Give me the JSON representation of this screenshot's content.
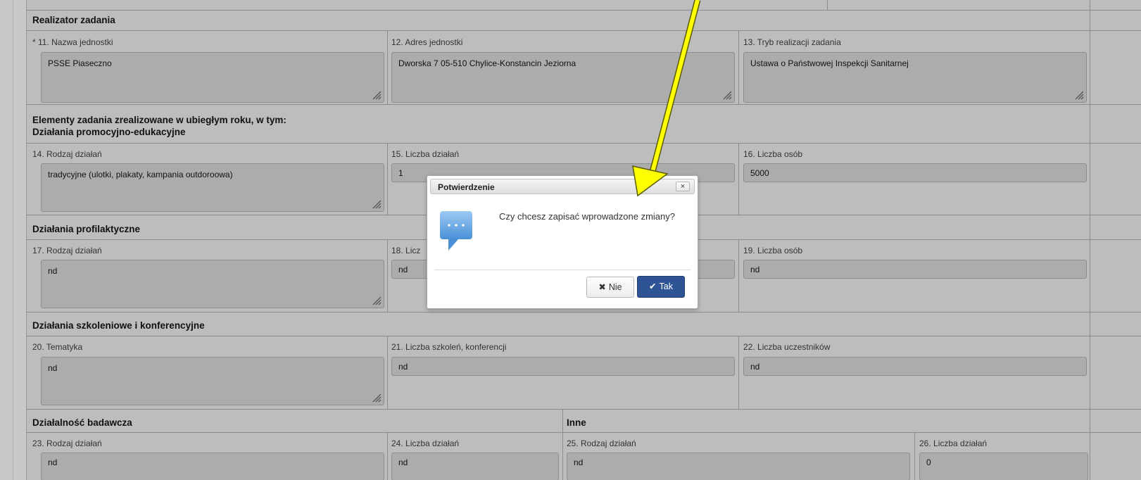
{
  "sections": {
    "realizator": "Realizator zadania",
    "elementy_line1": "Elementy zadania zrealizowane w ubiegłym roku, w tym:",
    "elementy_line2": "Działania promocyjno-edukacyjne",
    "profilaktyczne": "Działania profilaktyczne",
    "szkoleniowe": "Działania szkoleniowe i konferencyjne",
    "badawcza": "Działalność badawcza",
    "inne": "Inne"
  },
  "fields": {
    "f11": {
      "required_mark": "*",
      "label": "11. Nazwa jednostki",
      "value": "PSSE Piaseczno"
    },
    "f12": {
      "label": "12. Adres jednostki",
      "value": "Dworska 7 05-510 Chylice-Konstancin Jeziorna"
    },
    "f13": {
      "label": "13. Tryb realizacji zadania",
      "value": "Ustawa o Państwowej Inspekcji Sanitarnej"
    },
    "f14": {
      "label": "14. Rodzaj działań",
      "value": "tradycyjne (ulotki, plakaty, kampania outdoroowa)"
    },
    "f15": {
      "label": "15. Liczba działań",
      "value": "1"
    },
    "f16": {
      "label": "16. Liczba osób",
      "value": "5000"
    },
    "f17": {
      "label": "17. Rodzaj działań",
      "value": "nd"
    },
    "f18": {
      "label": "18. Licz",
      "value": "nd"
    },
    "f19": {
      "label": "19. Liczba osób",
      "value": "nd"
    },
    "f20": {
      "label": "20. Tematyka",
      "value": "nd"
    },
    "f21": {
      "label": "21. Liczba szkoleń, konferencji",
      "value": "nd"
    },
    "f22": {
      "label": "22. Liczba uczestników",
      "value": "nd"
    },
    "f23": {
      "label": "23. Rodzaj działań",
      "value": "nd"
    },
    "f24": {
      "label": "24. Liczba działań",
      "value": "nd"
    },
    "f25": {
      "label": "25. Rodzaj działań",
      "value": "nd"
    },
    "f26": {
      "label": "26. Liczba działań",
      "value": "0"
    }
  },
  "dialog": {
    "title": "Potwierdzenie",
    "close_glyph": "×",
    "message": "Czy chcesz zapisać wprowadzone zmiany?",
    "no_label": "Nie",
    "yes_label": "Tak",
    "no_glyph": "✖",
    "yes_glyph": "✔"
  },
  "colors": {
    "arrow": "#ffff00",
    "yes_button": "#2f5496",
    "speech_icon": "#5b9bd5"
  }
}
